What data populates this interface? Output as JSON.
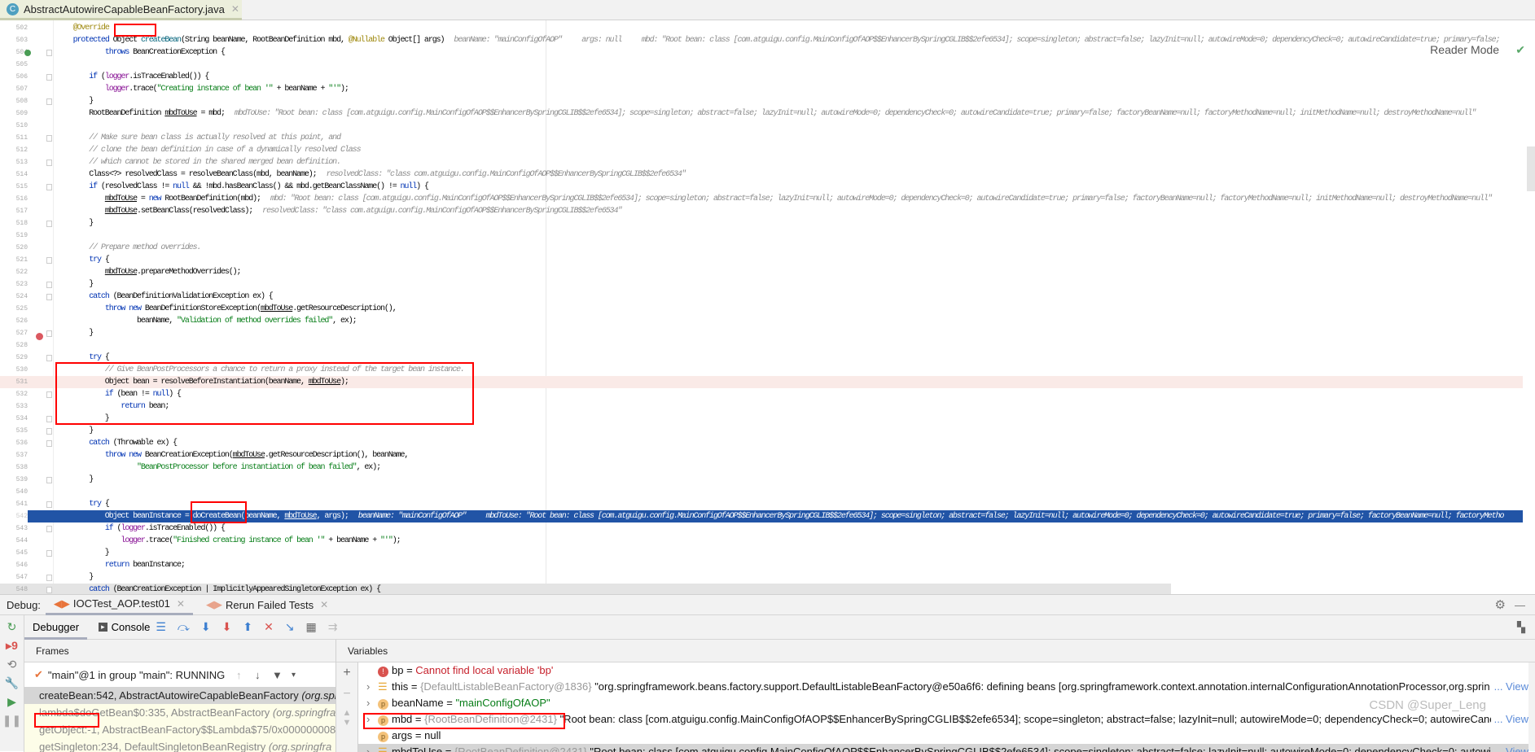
{
  "file_tab": {
    "title": "AbstractAutowireCapableBeanFactory.java",
    "icon": "class-icon"
  },
  "editor": {
    "reader_mode": "Reader Mode",
    "lines": [
      {
        "n": "502",
        "code": "    @Override"
      },
      {
        "n": "503",
        "code": "    protected Object createBean(String beanName, RootBeanDefinition mbd, @Nullable Object[] args)",
        "hint": "beanName: \"mainConfigOfAOP\"     args: null     mbd: \"Root bean: class [com.atguigu.config.MainConfigOfAOP$$EnhancerBySpringCGLIB$$2efe6534]; scope=singleton; abstract=false; lazyInit=null; autowireMode=0; dependencyCheck=0; autowireCandidate=true; primary=false;"
      },
      {
        "n": "504",
        "code": "            throws BeanCreationException {"
      },
      {
        "n": "505",
        "code": ""
      },
      {
        "n": "506",
        "code": "        if (logger.isTraceEnabled()) {"
      },
      {
        "n": "507",
        "code": "            logger.trace(\"Creating instance of bean '\" + beanName + \"'\");"
      },
      {
        "n": "508",
        "code": "        }"
      },
      {
        "n": "509",
        "code": "        RootBeanDefinition mbdToUse = mbd;",
        "hint": "mbdToUse: \"Root bean: class [com.atguigu.config.MainConfigOfAOP$$EnhancerBySpringCGLIB$$2efe6534]; scope=singleton; abstract=false; lazyInit=null; autowireMode=0; dependencyCheck=0; autowireCandidate=true; primary=false; factoryBeanName=null; factoryMethodName=null; initMethodName=null; destroyMethodName=null\""
      },
      {
        "n": "510",
        "code": ""
      },
      {
        "n": "511",
        "code": "        // Make sure bean class is actually resolved at this point, and"
      },
      {
        "n": "512",
        "code": "        // clone the bean definition in case of a dynamically resolved Class"
      },
      {
        "n": "513",
        "code": "        // which cannot be stored in the shared merged bean definition."
      },
      {
        "n": "514",
        "code": "        Class<?> resolvedClass = resolveBeanClass(mbd, beanName);",
        "hint": "resolvedClass: \"class com.atguigu.config.MainConfigOfAOP$$EnhancerBySpringCGLIB$$2efe6534\""
      },
      {
        "n": "515",
        "code": "        if (resolvedClass != null && !mbd.hasBeanClass() && mbd.getBeanClassName() != null) {"
      },
      {
        "n": "516",
        "code": "            mbdToUse = new RootBeanDefinition(mbd);",
        "hint": "mbd: \"Root bean: class [com.atguigu.config.MainConfigOfAOP$$EnhancerBySpringCGLIB$$2efe6534]; scope=singleton; abstract=false; lazyInit=null; autowireMode=0; dependencyCheck=0; autowireCandidate=true; primary=false; factoryBeanName=null; factoryMethodName=null; initMethodName=null; destroyMethodName=null\""
      },
      {
        "n": "517",
        "code": "            mbdToUse.setBeanClass(resolvedClass);",
        "hint": "resolvedClass: \"class com.atguigu.config.MainConfigOfAOP$$EnhancerBySpringCGLIB$$2efe6534\""
      },
      {
        "n": "518",
        "code": "        }"
      },
      {
        "n": "519",
        "code": ""
      },
      {
        "n": "520",
        "code": "        // Prepare method overrides."
      },
      {
        "n": "521",
        "code": "        try {"
      },
      {
        "n": "522",
        "code": "            mbdToUse.prepareMethodOverrides();"
      },
      {
        "n": "523",
        "code": "        }"
      },
      {
        "n": "524",
        "code": "        catch (BeanDefinitionValidationException ex) {"
      },
      {
        "n": "525",
        "code": "            throw new BeanDefinitionStoreException(mbdToUse.getResourceDescription(),"
      },
      {
        "n": "526",
        "code": "                    beanName, \"Validation of method overrides failed\", ex);"
      },
      {
        "n": "527",
        "code": "        }"
      },
      {
        "n": "528",
        "code": ""
      },
      {
        "n": "529",
        "code": "        try {"
      },
      {
        "n": "530",
        "code": "            // Give BeanPostProcessors a chance to return a proxy instead of the target bean instance."
      },
      {
        "n": "531",
        "code": "            Object bean = resolveBeforeInstantiation(beanName, mbdToUse);",
        "state": "bp"
      },
      {
        "n": "532",
        "code": "            if (bean != null) {"
      },
      {
        "n": "533",
        "code": "                return bean;"
      },
      {
        "n": "534",
        "code": "            }"
      },
      {
        "n": "535",
        "code": "        }"
      },
      {
        "n": "536",
        "code": "        catch (Throwable ex) {"
      },
      {
        "n": "537",
        "code": "            throw new BeanCreationException(mbdToUse.getResourceDescription(), beanName,"
      },
      {
        "n": "538",
        "code": "                    \"BeanPostProcessor before instantiation of bean failed\", ex);"
      },
      {
        "n": "539",
        "code": "        }"
      },
      {
        "n": "540",
        "code": ""
      },
      {
        "n": "541",
        "code": "        try {"
      },
      {
        "n": "542",
        "code": "            Object beanInstance = doCreateBean(beanName, mbdToUse, args);",
        "hint": "beanName: \"mainConfigOfAOP\"     mbdToUse: \"Root bean: class [com.atguigu.config.MainConfigOfAOP$$EnhancerBySpringCGLIB$$2efe6534]; scope=singleton; abstract=false; lazyInit=null; autowireMode=0; dependencyCheck=0; autowireCandidate=true; primary=false; factoryBeanName=null; factoryMetho",
        "state": "cur"
      },
      {
        "n": "543",
        "code": "            if (logger.isTraceEnabled()) {"
      },
      {
        "n": "544",
        "code": "                logger.trace(\"Finished creating instance of bean '\" + beanName + \"'\");"
      },
      {
        "n": "545",
        "code": "            }"
      },
      {
        "n": "546",
        "code": "            return beanInstance;"
      },
      {
        "n": "547",
        "code": "        }"
      },
      {
        "n": "548",
        "code": "        catch (BeanCreationException | ImplicitlyAppearedSingletonException ex) {",
        "state": "gray"
      }
    ]
  },
  "debug": {
    "label": "Debug:",
    "tabs": [
      {
        "label": "IOCTest_AOP.test01",
        "active": true
      },
      {
        "label": "Rerun Failed Tests",
        "active": false
      }
    ],
    "subtabs": {
      "debugger": "Debugger",
      "console": "Console"
    },
    "frames": {
      "header": "Frames",
      "thread": "\"main\"@1 in group \"main\": RUNNING",
      "items": [
        {
          "method": "createBean:542, AbstractAutowireCapableBeanFactory",
          "pkg": "(org.spr",
          "selected": true
        },
        {
          "method": "lambda$doGetBean$0:335, AbstractBeanFactory",
          "pkg": "(org.springfra"
        },
        {
          "method": "getObject:-1, AbstractBeanFactory$$Lambda$75/0x00000000800",
          "pkg": ""
        },
        {
          "method": "getSingleton:234, DefaultSingletonBeanRegistry",
          "pkg": "(org.springfra"
        }
      ]
    },
    "variables": {
      "header": "Variables",
      "view_label": "... View",
      "items": [
        {
          "kind": "error",
          "name": "bp",
          "eq": " = ",
          "value": "Cannot find local variable 'bp'"
        },
        {
          "kind": "field",
          "name": "this",
          "eq": " = ",
          "type": "{DefaultListableBeanFactory@1836}",
          "value": " \"org.springframework.beans.factory.support.DefaultListableBeanFactory@e50a6f6: defining beans [org.springframework.context.annotation.internalConfigurationAnnotationProcessor,org.sprin",
          "view": true
        },
        {
          "kind": "param",
          "name": "beanName",
          "eq": " = ",
          "strvalue": "\"mainConfigOfAOP\""
        },
        {
          "kind": "param",
          "name": "mbd",
          "eq": " = ",
          "type": "{RootBeanDefinition@2431}",
          "value": " \"Root bean: class [com.atguigu.config.MainConfigOfAOP$$EnhancerBySpringCGLIB$$2efe6534]; scope=singleton; abstract=false; lazyInit=null; autowireMode=0; dependencyCheck=0; autowireCand",
          "view": true
        },
        {
          "kind": "param",
          "name": "args",
          "eq": " = ",
          "value": "null"
        },
        {
          "kind": "field",
          "name": "mbdToUse",
          "eq": " = ",
          "type": "{RootBeanDefinition@2431}",
          "value": " \"Root bean: class [com.atguigu.config.MainConfigOfAOP$$EnhancerBySpringCGLIB$$2efe6534]; scope=singleton; abstract=false; lazyInit=null; autowireMode=0; dependencyCheck=0; autowir",
          "view": true,
          "selected": true
        }
      ]
    }
  },
  "watermark": "CSDN @Super_Leng",
  "colors": {
    "current_line": "#2154a6",
    "breakpoint_line": "#faeae7",
    "annotation_box": "#ff0000"
  }
}
